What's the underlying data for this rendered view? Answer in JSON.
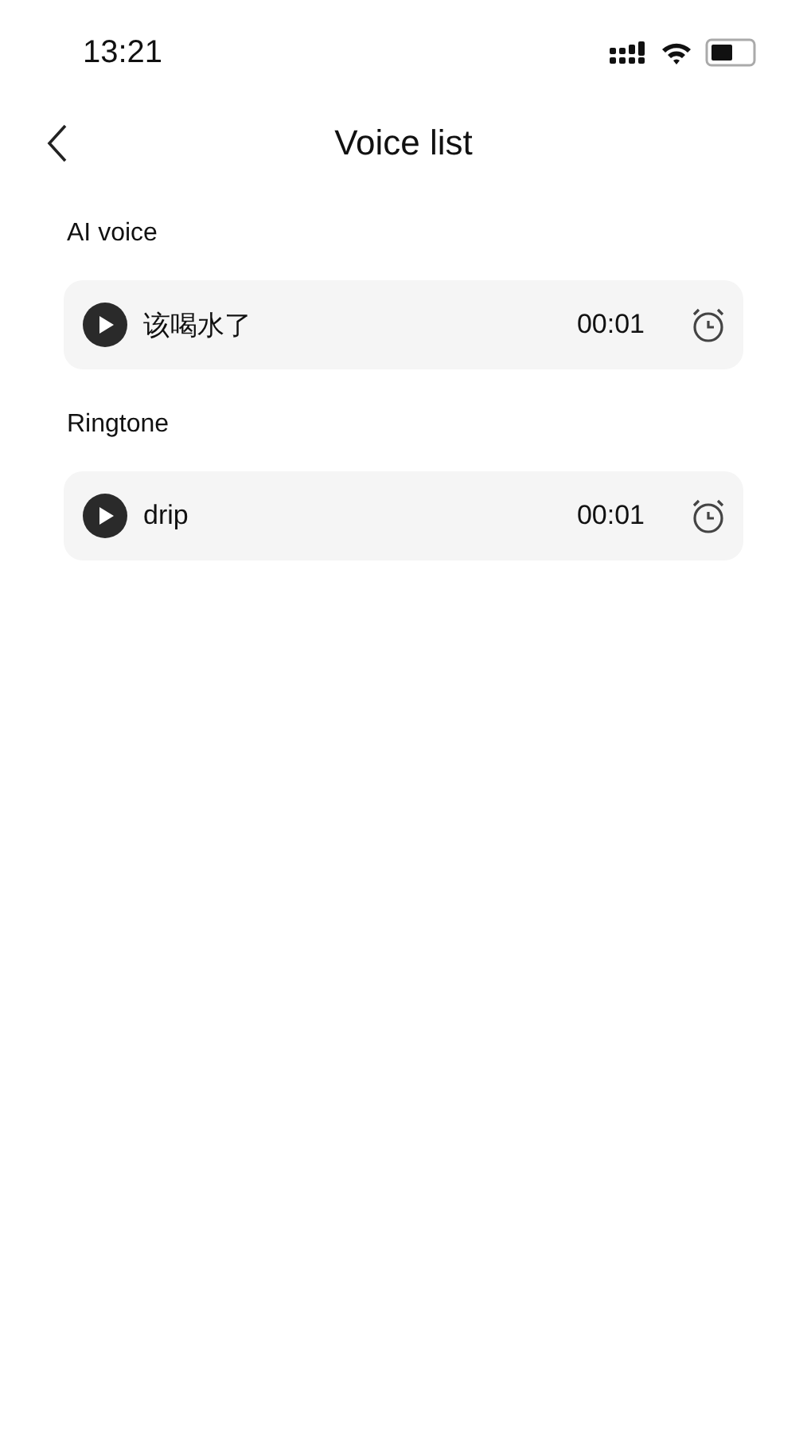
{
  "status_bar": {
    "time": "13:21"
  },
  "header": {
    "title": "Voice list"
  },
  "sections": [
    {
      "title": "AI voice",
      "items": [
        {
          "name": "该喝水了",
          "duration": "00:01"
        }
      ]
    },
    {
      "title": "Ringtone",
      "items": [
        {
          "name": "drip",
          "duration": "00:01"
        }
      ]
    }
  ]
}
